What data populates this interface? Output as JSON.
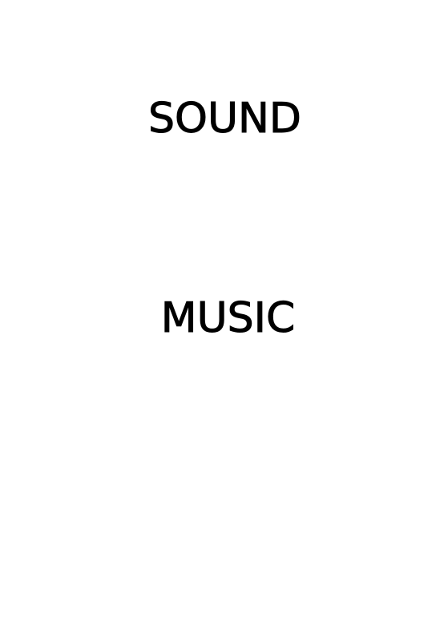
{
  "page": {
    "headings": [
      {
        "text": "SOUND"
      },
      {
        "text": "MUSIC"
      }
    ]
  },
  "colors": {
    "background": "#ffffff",
    "text": "#000000"
  }
}
